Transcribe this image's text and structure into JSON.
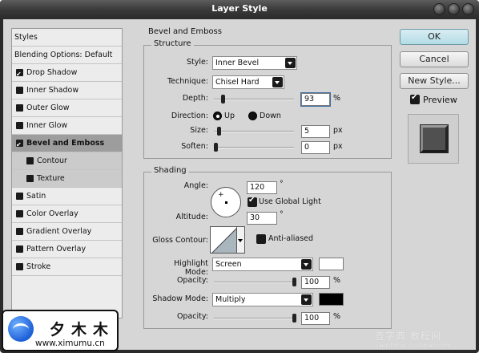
{
  "window": {
    "title": "Layer Style"
  },
  "left_panel": {
    "header": "Styles",
    "blending": "Blending Options: Default",
    "items": [
      {
        "label": "Drop Shadow",
        "checked": true,
        "selected": false,
        "sub": false
      },
      {
        "label": "Inner Shadow",
        "checked": false,
        "selected": false,
        "sub": false
      },
      {
        "label": "Outer Glow",
        "checked": false,
        "selected": false,
        "sub": false
      },
      {
        "label": "Inner Glow",
        "checked": false,
        "selected": false,
        "sub": false
      },
      {
        "label": "Bevel and Emboss",
        "checked": true,
        "selected": true,
        "sub": false
      },
      {
        "label": "Contour",
        "checked": false,
        "selected": false,
        "sub": true
      },
      {
        "label": "Texture",
        "checked": false,
        "selected": false,
        "sub": true
      },
      {
        "label": "Satin",
        "checked": false,
        "selected": false,
        "sub": false
      },
      {
        "label": "Color Overlay",
        "checked": false,
        "selected": false,
        "sub": false
      },
      {
        "label": "Gradient Overlay",
        "checked": false,
        "selected": false,
        "sub": false
      },
      {
        "label": "Pattern Overlay",
        "checked": false,
        "selected": false,
        "sub": false
      },
      {
        "label": "Stroke",
        "checked": false,
        "selected": false,
        "sub": false
      }
    ]
  },
  "bevel": {
    "section_title": "Bevel and Emboss",
    "structure_title": "Structure",
    "style_label": "Style:",
    "style_value": "Inner Bevel",
    "technique_label": "Technique:",
    "technique_value": "Chisel Hard",
    "depth_label": "Depth:",
    "depth_value": "93",
    "depth_unit": "%",
    "depth_level": 0.093,
    "direction_label": "Direction:",
    "direction_up": "Up",
    "direction_down": "Down",
    "direction_selected": "Up",
    "size_label": "Size:",
    "size_value": "5",
    "size_unit": "px",
    "size_level": 0.04,
    "soften_label": "Soften:",
    "soften_value": "0",
    "soften_unit": "px",
    "soften_level": 0.0
  },
  "shading": {
    "section_title": "Shading",
    "angle_label": "Angle:",
    "angle_value": "120",
    "angle_unit": "°",
    "use_global_light_label": "Use Global Light",
    "use_global_light": true,
    "altitude_label": "Altitude:",
    "altitude_value": "30",
    "altitude_unit": "°",
    "gloss_contour_label": "Gloss Contour:",
    "anti_aliased_label": "Anti-aliased",
    "anti_aliased": false,
    "highlight_mode_label": "Highlight Mode:",
    "highlight_mode_value": "Screen",
    "highlight_color": "#ffffff",
    "highlight_opacity_label": "Opacity:",
    "highlight_opacity_value": "100",
    "highlight_opacity_unit": "%",
    "highlight_opacity_level": 1.0,
    "shadow_mode_label": "Shadow Mode:",
    "shadow_mode_value": "Multiply",
    "shadow_color": "#000000",
    "shadow_opacity_label": "Opacity:",
    "shadow_opacity_value": "100",
    "shadow_opacity_unit": "%",
    "shadow_opacity_level": 1.0
  },
  "actions": {
    "ok_label": "OK",
    "cancel_label": "Cancel",
    "new_style_label": "New Style...",
    "preview_label": "Preview",
    "preview_checked": true
  },
  "watermark": {
    "logo_text": "夕木木",
    "url": "www.ximumu.cn",
    "right_text": "查字典 教程网",
    "right_url": "jiaocheng.chazidian.com"
  },
  "colors": {
    "dialog_bg": "#d6d6d6",
    "title_bar": "#3a3a3a",
    "ok_button": "#b3dbe5",
    "selected_row": "#9d9d9d"
  }
}
